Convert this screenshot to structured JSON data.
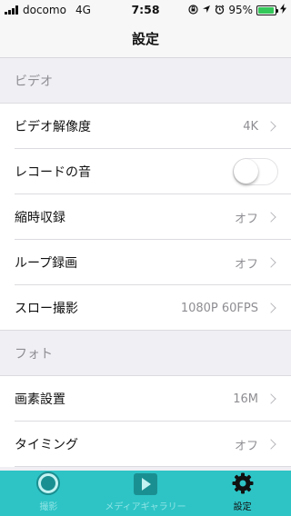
{
  "status_bar": {
    "carrier": "docomo",
    "network": "4G",
    "time": "7:58",
    "battery_percent": "95%",
    "battery_level": 0.95
  },
  "nav": {
    "title": "設定"
  },
  "sections": {
    "video": {
      "header": "ビデオ",
      "rows": {
        "resolution": {
          "label": "ビデオ解像度",
          "value": "4K"
        },
        "record_sound": {
          "label": "レコードの音",
          "toggle_on": false
        },
        "timelapse": {
          "label": "縮時収録",
          "value": "オフ"
        },
        "loop": {
          "label": "ループ録画",
          "value": "オフ"
        },
        "slowmo": {
          "label": "スロー撮影",
          "value": "1080P 60FPS"
        }
      }
    },
    "photo": {
      "header": "フォト",
      "rows": {
        "pixel": {
          "label": "画素設置",
          "value": "16M"
        },
        "timing": {
          "label": "タイミング",
          "value": "オフ"
        }
      }
    }
  },
  "tabbar": {
    "tabs": [
      {
        "label": "撮影",
        "icon": "camera-icon"
      },
      {
        "label": "メディアギャラリー",
        "icon": "gallery-icon"
      },
      {
        "label": "設定",
        "icon": "gear-icon"
      }
    ]
  },
  "colors": {
    "accent": "#2ec4c6",
    "battery": "#34c759"
  }
}
